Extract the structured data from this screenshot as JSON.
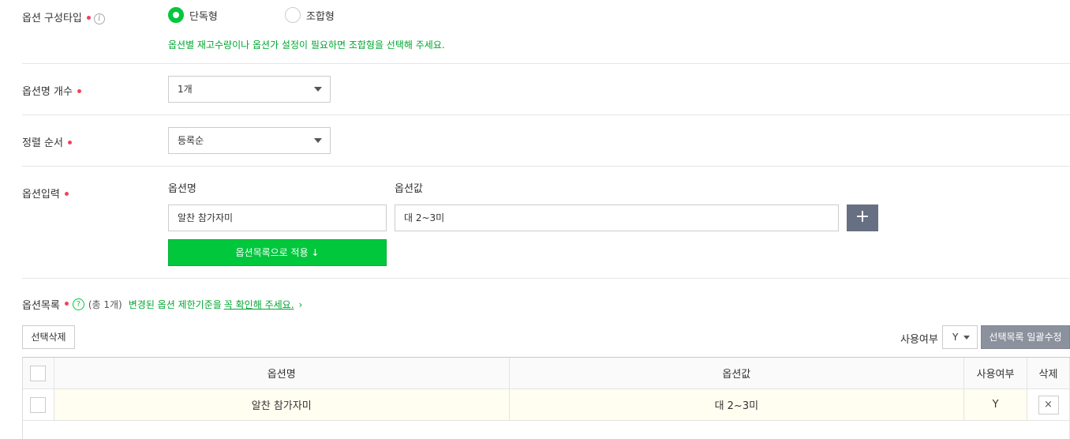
{
  "option_type": {
    "label": "옵션 구성타입",
    "choices": [
      {
        "label": "단독형",
        "selected": true
      },
      {
        "label": "조합형",
        "selected": false
      }
    ],
    "help": "옵션별 재고수량이나 옵션가 설정이 필요하면 조합형을 선택해 주세요."
  },
  "option_count": {
    "label": "옵션명 개수",
    "value": "1개"
  },
  "sort_order": {
    "label": "정렬 순서",
    "value": "등록순"
  },
  "option_input": {
    "label": "옵션입력",
    "name_header": "옵션명",
    "value_header": "옵션값",
    "name_value": "알찬 참가자미",
    "value_value": "대 2~3미",
    "plus_label": "+",
    "apply_button": "옵션목록으로 적용 ↓"
  },
  "option_list": {
    "label": "옵션목록",
    "help_icon": "?",
    "count_text": "(총 1개)",
    "notice_prefix": "변경된 옵션 제한기준을",
    "notice_link": "꼭 확인해 주세요.",
    "notice_arrow": "›",
    "delete_selected": "선택삭제",
    "usage_label": "사용여부",
    "usage_value": "Y",
    "bulk_edit": "선택목록 일괄수정"
  },
  "table": {
    "headers": {
      "name": "옵션명",
      "value": "옵션값",
      "usage": "사용여부",
      "delete": "삭제"
    },
    "rows": [
      {
        "name": "알찬 참가자미",
        "value": "대 2~3미",
        "usage": "Y",
        "delete": "×"
      }
    ]
  },
  "colors": {
    "accent": "#00c73c",
    "required_dot": "#f0435a",
    "help_text": "#00a630"
  }
}
